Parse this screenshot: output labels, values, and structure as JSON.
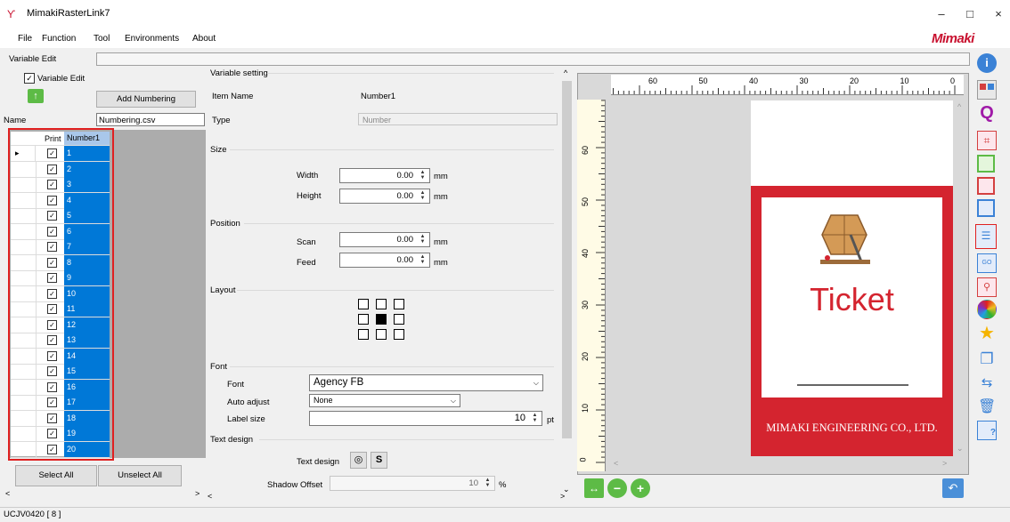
{
  "window": {
    "title": "MimakiRasterLink7",
    "minimize": "–",
    "maximize": "□",
    "close": "×"
  },
  "menu": [
    "File",
    "Function",
    "Tool",
    "Environments",
    "About"
  ],
  "logo": "Mimaki",
  "variable_edit": {
    "header_label": "Variable Edit",
    "checkbox_label": "Variable Edit",
    "checkbox_checked": true,
    "add_numbering": "Add Numbering",
    "name_label": "Name",
    "name_value": "Numbering.csv"
  },
  "grid": {
    "col_print": "Print",
    "col_number": "Number1",
    "rows": [
      "1",
      "2",
      "3",
      "4",
      "5",
      "6",
      "7",
      "8",
      "9",
      "10",
      "11",
      "12",
      "13",
      "14",
      "15",
      "16",
      "17",
      "18",
      "19",
      "20"
    ]
  },
  "buttons": {
    "select_all": "Select All",
    "unselect_all": "Unselect All"
  },
  "settings": {
    "variable_setting": "Variable setting",
    "item_name_label": "Item Name",
    "item_name_value": "Number1",
    "type_label": "Type",
    "type_value": "Number",
    "size_group": "Size",
    "width_label": "Width",
    "width_value": "0.00",
    "height_label": "Height",
    "height_value": "0.00",
    "unit_mm": "mm",
    "position_group": "Position",
    "scan_label": "Scan",
    "scan_value": "0.00",
    "feed_label": "Feed",
    "feed_value": "0.00",
    "layout_group": "Layout",
    "font_group": "Font",
    "font_label": "Font",
    "font_value": "Agency FB",
    "auto_adjust_label": "Auto adjust",
    "auto_adjust_value": "None",
    "label_size_label": "Label size",
    "label_size_value": "10",
    "unit_pt": "pt",
    "text_design_group": "Text design",
    "text_design_label": "Text design",
    "text_design_btn1": "◎",
    "text_design_btn2": "S",
    "shadow_offset_label": "Shadow Offset",
    "shadow_offset_value": "10",
    "unit_pct": "%"
  },
  "ruler": {
    "h_labels": [
      "60",
      "50",
      "40",
      "30",
      "20",
      "10",
      "0"
    ],
    "v_labels": [
      "60",
      "50",
      "40",
      "30",
      "20",
      "10",
      "0"
    ]
  },
  "ticket": {
    "title": "Ticket",
    "company": "MIMAKI ENGINEERING CO., LTD."
  },
  "status": {
    "printer": "UCJV0420 [ 8 ]"
  },
  "colors": {
    "accent_blue": "#0078d7",
    "brand_red": "#c8102e",
    "ticket_red": "#d4242f"
  }
}
